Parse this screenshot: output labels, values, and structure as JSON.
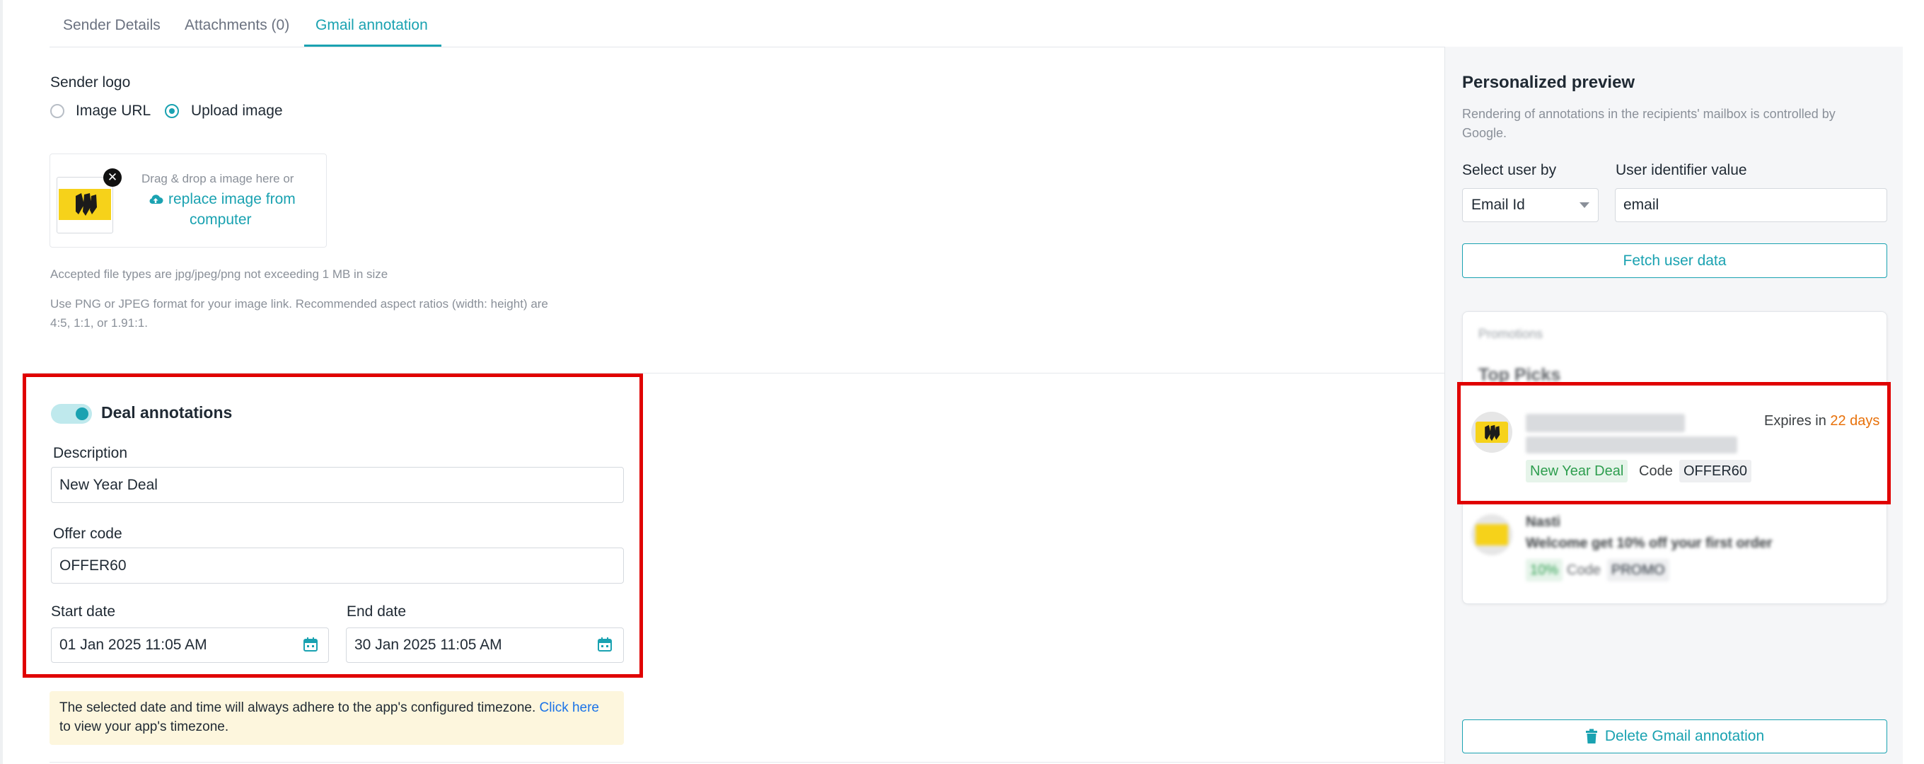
{
  "tabs": [
    {
      "label": "Sender Details"
    },
    {
      "label": "Attachments (0)"
    },
    {
      "label": "Gmail annotation"
    }
  ],
  "sender_logo": {
    "label": "Sender logo",
    "option_url": "Image URL",
    "option_upload": "Upload image",
    "selected": "Upload image",
    "drop_hint": "Drag & drop a image here or",
    "replace_link_line1": "replace image from",
    "replace_link_line2": "computer",
    "accepted_text": "Accepted file types are jpg/jpeg/png not exceeding 1 MB in size",
    "format_text_line1": "Use PNG or JPEG format for your image link. Recommended aspect ratios (width: height) are",
    "format_text_line2": "4:5, 1:1, or 1.91:1."
  },
  "deal": {
    "title": "Deal annotations",
    "enabled": true,
    "description_label": "Description",
    "description_value": "New Year Deal",
    "offer_label": "Offer code",
    "offer_value": "OFFER60",
    "start_label": "Start date",
    "start_value": "01 Jan 2025 11:05 AM",
    "end_label": "End date",
    "end_value": "30 Jan 2025 11:05 AM"
  },
  "notice": {
    "text": "The selected date and time will always adhere to the app's configured timezone.",
    "link": "Click here",
    "text2": "to view your app's timezone."
  },
  "preview": {
    "title": "Personalized preview",
    "subtitle_line1": "Rendering of annotations in the recipients' mailbox is controlled by",
    "subtitle_line2": "Google.",
    "select_user_label": "Select user by",
    "select_user_value": "Email Id",
    "identifier_label": "User identifier value",
    "identifier_value": "email",
    "fetch_button": "Fetch user data",
    "card": {
      "section": "Promotions",
      "heading": "Top Picks",
      "item1": {
        "expires_prefix": "Expires in",
        "expires_value": "22 days",
        "deal_chip": "New Year Deal",
        "code_label": "Code",
        "code_value": "OFFER60"
      },
      "item2": {
        "sender": "Nasti",
        "subject": "Welcome get 10% off your first order",
        "deal_chip": "10%",
        "code_label": "Code",
        "code_value": "PROMO"
      }
    },
    "delete_button": "Delete Gmail annotation"
  },
  "colors": {
    "accent": "#1aa2b1",
    "highlight_box": "#e00000",
    "expires_days": "#e8710a",
    "notice_bg": "#fdf6dd"
  }
}
